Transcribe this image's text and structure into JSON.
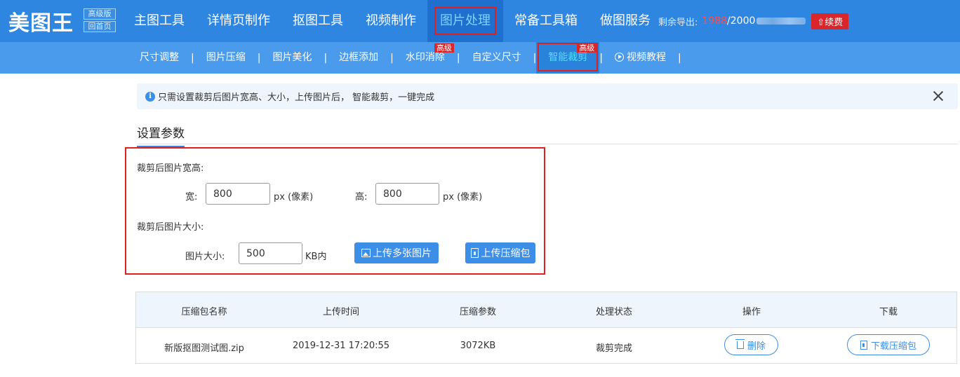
{
  "logo": {
    "text": "美图王",
    "badge_top": "高级版",
    "badge_bottom": "回首页"
  },
  "mainnav": [
    {
      "label": "主图工具"
    },
    {
      "label": "详情页制作"
    },
    {
      "label": "抠图工具"
    },
    {
      "label": "视频制作"
    },
    {
      "label": "图片处理",
      "active": true
    },
    {
      "label": "常备工具箱"
    },
    {
      "label": "做图服务"
    }
  ],
  "quota": {
    "label": "剩余导出:",
    "used": "1988",
    "total": "/2000",
    "renew_label": "续费"
  },
  "subnav": [
    {
      "label": "尺寸调整"
    },
    {
      "label": "图片压缩"
    },
    {
      "label": "图片美化"
    },
    {
      "label": "边框添加"
    },
    {
      "label": "水印消除",
      "badge": "高级"
    },
    {
      "label": "自定义尺寸"
    },
    {
      "label": "智能裁剪",
      "badge": "高级",
      "active": true
    },
    {
      "label": "视频教程"
    }
  ],
  "tip": {
    "text": "只需设置裁剪后图片宽高、大小，上传图片后， 智能裁剪，一键完成",
    "info_glyph": "i"
  },
  "settings": {
    "title": "设置参数",
    "size_section_label": "裁剪后图片宽高:",
    "width_label": "宽:",
    "width_value": "800",
    "width_unit": "px (像素)",
    "height_label": "高:",
    "height_value": "800",
    "height_unit": "px (像素)",
    "filesize_section_label": "裁剪后图片大小:",
    "filesize_label": "图片大小:",
    "filesize_value": "500",
    "filesize_unit": "KB内",
    "upload_multi_label": "上传多张图片",
    "upload_zip_label": "上传压缩包"
  },
  "table": {
    "headers": [
      "压缩包名称",
      "上传时间",
      "压缩参数",
      "处理状态",
      "操作",
      "下载"
    ],
    "rows": [
      {
        "name": "新版抠图测试图.zip",
        "time": "2019-12-31 17:20:55",
        "param": "3072KB",
        "status": "裁剪完成",
        "delete_label": "删除",
        "download_label": "下载压缩包"
      }
    ]
  },
  "colors": {
    "primary": "#2f86e0",
    "subbar": "#4a9bec",
    "highlight_red": "#e02020",
    "renew_red": "#d8262b"
  }
}
